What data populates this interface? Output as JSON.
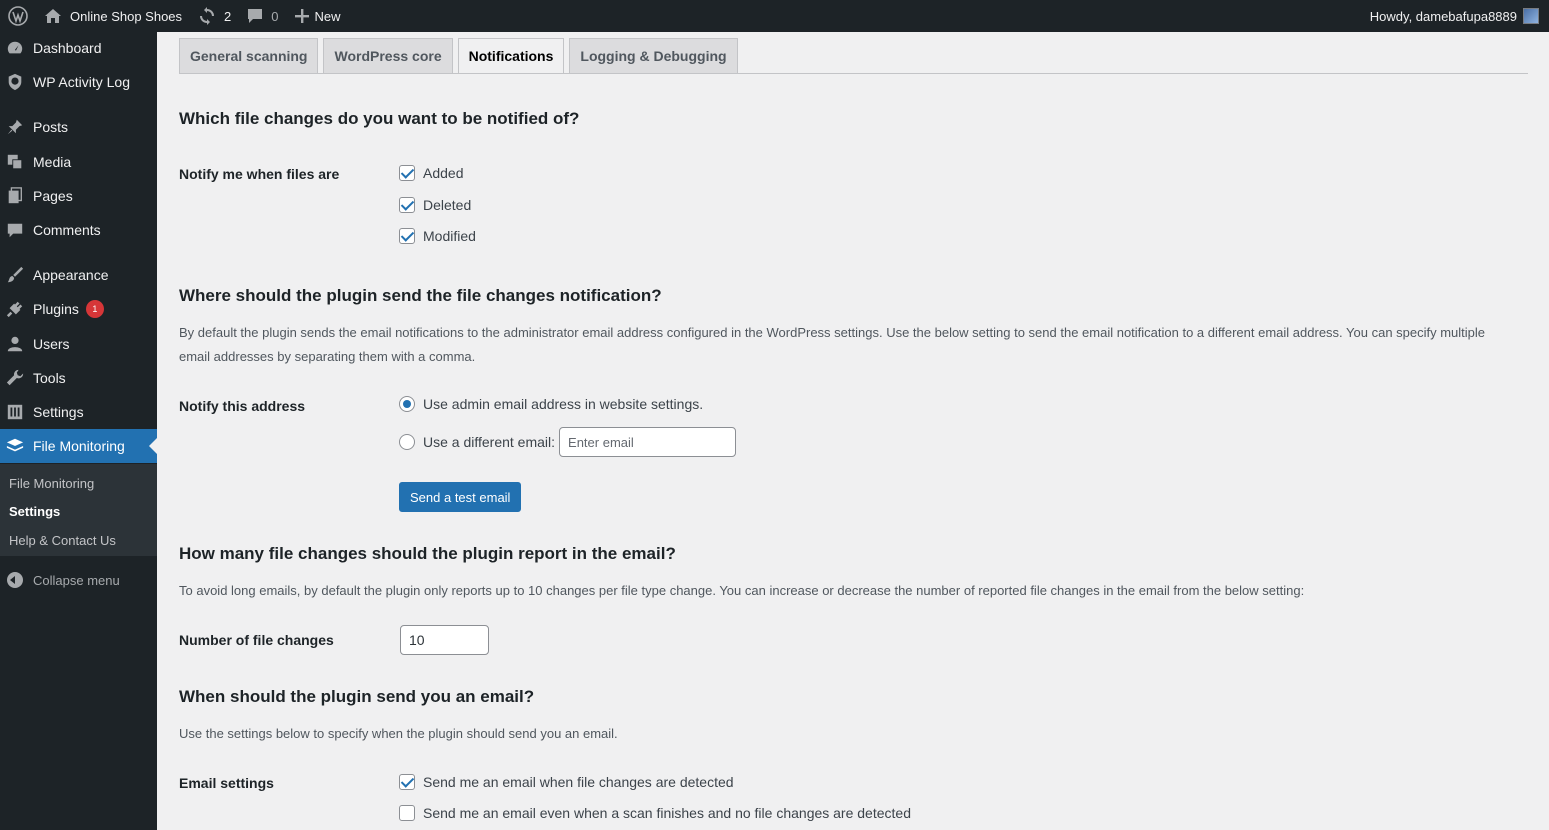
{
  "adminbar": {
    "site_name": "Online Shop Shoes",
    "updates_count": "2",
    "comments_count": "0",
    "new_label": "New",
    "howdy": "Howdy, damebafupa8889"
  },
  "sidebar": {
    "items": [
      {
        "label": "Dashboard",
        "icon": "dashboard-icon"
      },
      {
        "label": "WP Activity Log",
        "icon": "shield-icon"
      },
      {
        "label": "Posts",
        "icon": "pin-icon"
      },
      {
        "label": "Media",
        "icon": "media-icon"
      },
      {
        "label": "Pages",
        "icon": "pages-icon"
      },
      {
        "label": "Comments",
        "icon": "comment-icon"
      },
      {
        "label": "Appearance",
        "icon": "brush-icon"
      },
      {
        "label": "Plugins",
        "icon": "plugin-icon",
        "badge": "1"
      },
      {
        "label": "Users",
        "icon": "user-icon"
      },
      {
        "label": "Tools",
        "icon": "wrench-icon"
      },
      {
        "label": "Settings",
        "icon": "settings-icon"
      },
      {
        "label": "File Monitoring",
        "icon": "layers-icon"
      }
    ],
    "submenu": [
      "File Monitoring",
      "Settings",
      "Help & Contact Us"
    ],
    "collapse_label": "Collapse menu"
  },
  "tabs": [
    "General scanning",
    "WordPress core",
    "Notifications",
    "Logging & Debugging"
  ],
  "sections": {
    "s1_title": "Which file changes do you want to be notified of?",
    "notify_label": "Notify me when files are",
    "opt_added": "Added",
    "opt_deleted": "Deleted",
    "opt_modified": "Modified",
    "s2_title": "Where should the plugin send the file changes notification?",
    "s2_desc": "By default the plugin sends the email notifications to the administrator email address configured in the WordPress settings. Use the below setting to send the email notification to a different email address. You can specify multiple email addresses by separating them with a comma.",
    "address_label": "Notify this address",
    "radio_admin": "Use admin email address in website settings.",
    "radio_different": "Use a different email:",
    "email_placeholder": "Enter email",
    "test_button": "Send a test email",
    "s3_title": "How many file changes should the plugin report in the email?",
    "s3_desc": "To avoid long emails, by default the plugin only reports up to 10 changes per file type change. You can increase or decrease the number of reported file changes in the email from the below setting:",
    "num_label": "Number of file changes",
    "num_value": "10",
    "s4_title": "When should the plugin send you an email?",
    "s4_desc": "Use the settings below to specify when the plugin should send you an email.",
    "email_settings_label": "Email settings",
    "email_opt1": "Send me an email when file changes are detected",
    "email_opt2": "Send me an email even when a scan finishes and no file changes are detected"
  },
  "colors": {
    "accent": "#2271b1",
    "sidebar_bg": "#1d2327",
    "badge": "#d63638"
  }
}
